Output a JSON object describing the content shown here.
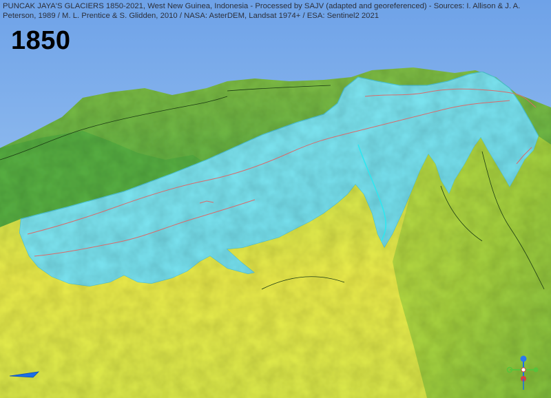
{
  "map": {
    "caption": "PUNCAK JAYA'S GLACIERS 1850-2021, West New Guinea, Indonesia - Processed by SAJV (adapted and georeferenced) - Sources: I. Allison & J. A. Peterson, 1989 / M. L. Prentice & S. Glidden, 2010 / NASA: AsterDEM, Landsat 1974+ / ESA: Sentinel2 2021",
    "year": "1850"
  },
  "colors": {
    "sky_top": "#6ea2e8",
    "sky_bottom": "#a9d0f5",
    "glacier": "#7de6f0",
    "glacier_edge": "#4fc6d6",
    "boundary_line": "#d86b6b",
    "terrain_high": "#7fbf3a",
    "terrain_low": "#f0ea4a"
  },
  "icons": {
    "north_arrow": "blue-arrow-icon",
    "axis_gizmo": "axis-gizmo-icon"
  }
}
